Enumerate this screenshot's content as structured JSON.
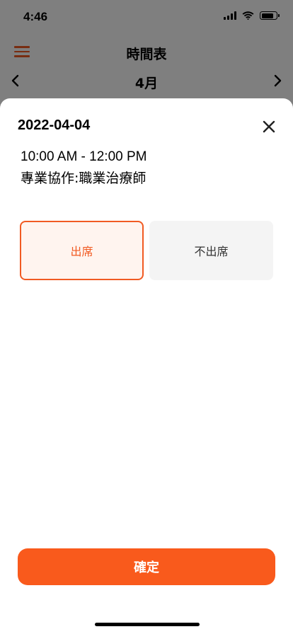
{
  "status_bar": {
    "time": "4:46"
  },
  "nav": {
    "title": "時間表"
  },
  "month_bar": {
    "month": "4月"
  },
  "sheet": {
    "date": "2022-04-04",
    "time_range": "10:00 AM - 12:00 PM",
    "session": "專業協作:職業治療師",
    "options": {
      "attend": "出席",
      "absent": "不出席"
    },
    "selected_option": "attend",
    "confirm_label": "確定"
  },
  "colors": {
    "accent": "#f15a22",
    "confirm_button": "#f95a1c",
    "selected_bg": "#fff4ef",
    "unselected_bg": "#f4f4f4"
  },
  "icons": {
    "menu": "hamburger-menu-icon",
    "prev": "chevron-left-icon",
    "next": "chevron-right-icon",
    "close": "close-icon",
    "wifi": "wifi-icon",
    "battery": "battery-icon",
    "signal": "cellular-signal-icon"
  },
  "battery_level": 0.85
}
